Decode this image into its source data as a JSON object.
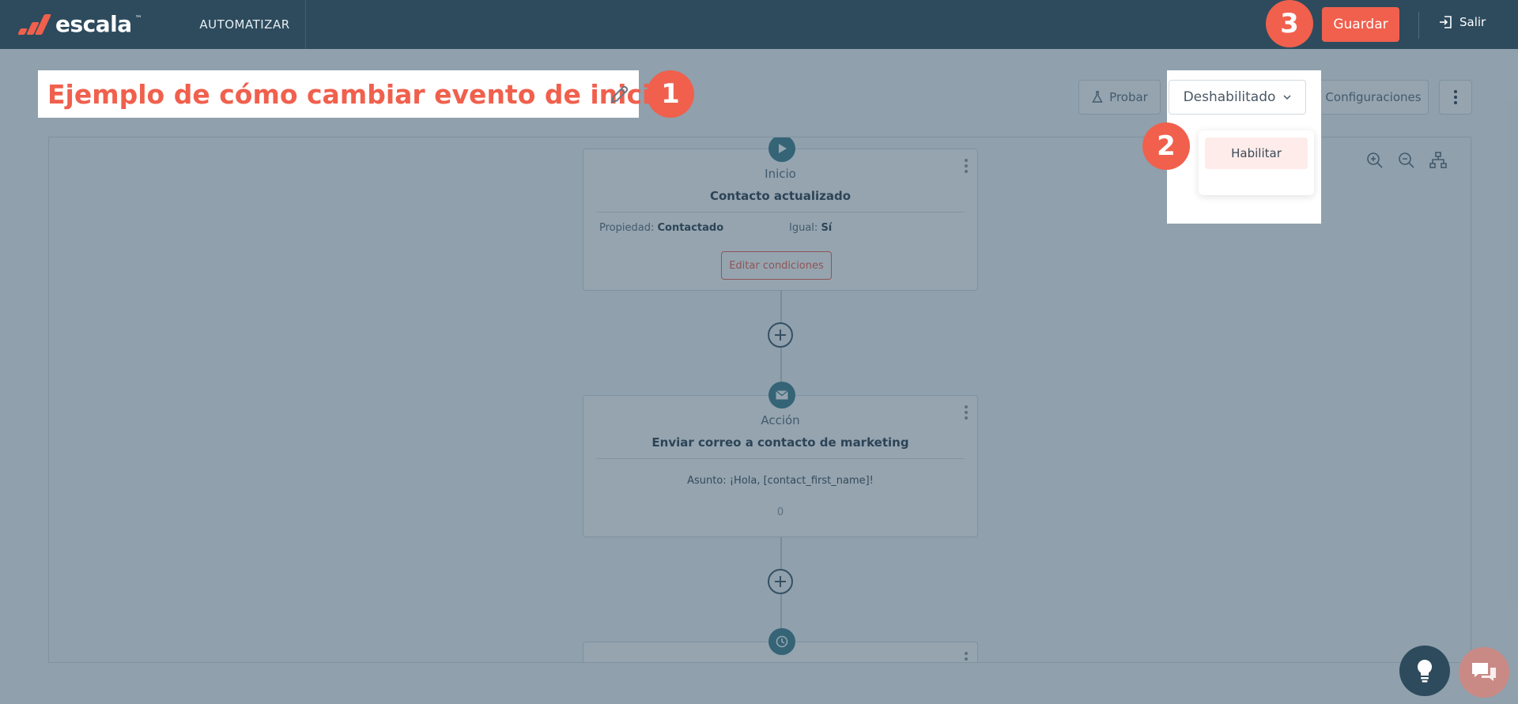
{
  "topbar": {
    "logo_text": "escala",
    "logo_tm": "™",
    "nav_tab": "AUTOMATIZAR",
    "save_label": "Guardar",
    "logout_label": "Salir"
  },
  "header": {
    "title": "Ejemplo de cómo cambiar evento de inicio",
    "test_label": "Probar",
    "status_label": "Deshabilitado",
    "status_menu_item": "Habilitar",
    "settings_label": "Configuraciones"
  },
  "canvas": {
    "start_node": {
      "type": "Inicio",
      "name": "Contacto actualizado",
      "prop_label": "Propiedad:",
      "prop_value": "Contactado",
      "equal_label": "Igual:",
      "equal_value": "Sí",
      "edit_label": "Editar condiciones"
    },
    "action_node": {
      "type": "Acción",
      "name": "Enviar correo a contacto de marketing",
      "subject_label": "Asunto:",
      "subject_value": "¡Hola, [contact_first_name]!",
      "count": "0"
    }
  },
  "steps": [
    "1",
    "2",
    "3"
  ],
  "colors": {
    "brand": "#f0604d",
    "topbar": "#2d4b5d",
    "accent": "#3d7f8c"
  },
  "icons": [
    "edit-pencil-icon",
    "flask-icon",
    "chevron-down-icon",
    "kebab-icon",
    "zoom-in-icon",
    "zoom-out-icon",
    "tree-icon",
    "play-icon",
    "mail-icon",
    "clock-icon",
    "plus-icon",
    "logout-icon",
    "lightbulb-icon",
    "chat-icon"
  ]
}
